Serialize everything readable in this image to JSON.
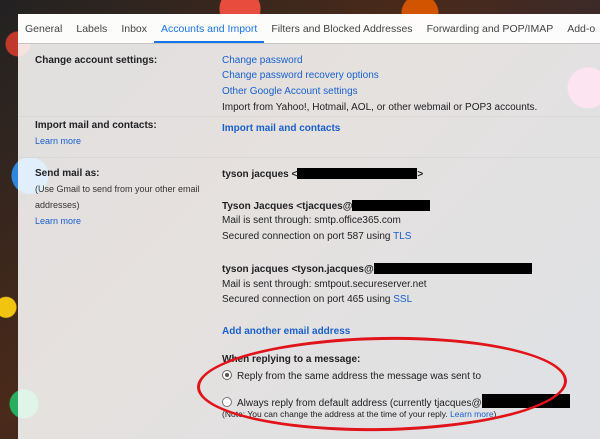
{
  "tabs": [
    {
      "label": "General"
    },
    {
      "label": "Labels"
    },
    {
      "label": "Inbox"
    },
    {
      "label": "Accounts and Import"
    },
    {
      "label": "Filters and Blocked Addresses"
    },
    {
      "label": "Forwarding and POP/IMAP"
    },
    {
      "label": "Add-o"
    }
  ],
  "change_account": {
    "label": "Change account settings:",
    "links": [
      "Change password",
      "Change password recovery options",
      "Other Google Account settings"
    ],
    "note": "Import from Yahoo!, Hotmail, AOL, or other webmail or POP3 accounts."
  },
  "import_mail": {
    "label": "Import mail and contacts:",
    "learn_more": "Learn more",
    "action": "Import mail and contacts"
  },
  "send_mail": {
    "label": "Send mail as:",
    "sublabel": "(Use Gmail to send from your other email addresses)",
    "learn_more": "Learn more",
    "accounts": [
      {
        "name": "tyson jacques <",
        "tail": ">"
      },
      {
        "name": "Tyson Jacques <tjacques@",
        "through": "Mail is sent through: smtp.office365.com",
        "secured": "Secured connection on port 587 using ",
        "proto": "TLS"
      },
      {
        "name": "tyson jacques <tyson.jacques@",
        "through": "Mail is sent through: smtpout.secureserver.net",
        "secured": "Secured connection on port 465 using ",
        "proto": "SSL"
      }
    ],
    "add_address": "Add another email address",
    "reply_heading": "When replying to a message:",
    "reply_option_1": "Reply from the same address the message was sent to",
    "reply_option_2": "Always reply from default address (currently tjacques@",
    "note": "(Note: You can change the address at the time of your reply. ",
    "note_link": "Learn more",
    "note_end": ")"
  },
  "colors": {
    "link": "#1a5fcc",
    "active_tab": "#1a73e8",
    "annotation": "#e0141a"
  }
}
